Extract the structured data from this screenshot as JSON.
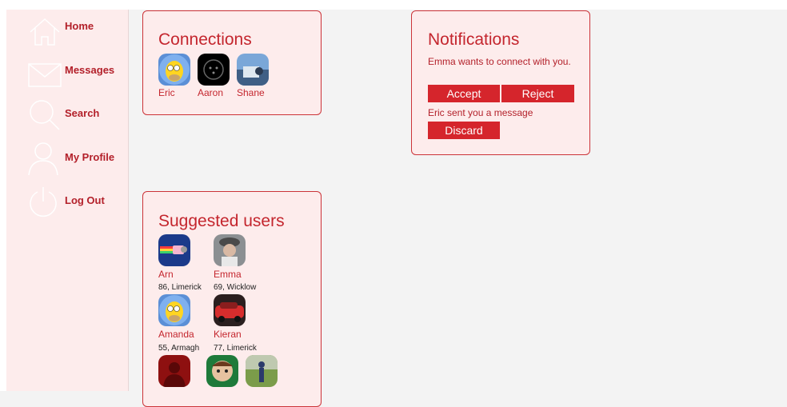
{
  "sidebar": {
    "items": [
      {
        "label": "Home",
        "icon": "home-icon"
      },
      {
        "label": "Messages",
        "icon": "envelope-icon"
      },
      {
        "label": "Search",
        "icon": "search-icon"
      },
      {
        "label": "My Profile",
        "icon": "user-icon"
      },
      {
        "label": "Log Out",
        "icon": "power-icon"
      }
    ]
  },
  "connections": {
    "title": "Connections",
    "users": [
      {
        "name": "Eric",
        "avatar": "homer-avatar-icon"
      },
      {
        "name": "Aaron",
        "avatar": "dark-avatar-icon"
      },
      {
        "name": "Shane",
        "avatar": "scene-avatar-icon"
      }
    ]
  },
  "notifications": {
    "title": "Notifications",
    "items": [
      {
        "text": "Emma wants to connect with you.",
        "actions": [
          "Accept",
          "Reject"
        ]
      },
      {
        "text": "Eric sent you a message",
        "actions": [
          "Discard"
        ]
      }
    ]
  },
  "suggested": {
    "title": "Suggested users",
    "users": [
      {
        "name": "Arn",
        "meta": "86, Limerick"
      },
      {
        "name": "Emma",
        "meta": "69, Wicklow"
      },
      {
        "name": "Amanda",
        "meta": "55, Armagh"
      },
      {
        "name": "Kieran",
        "meta": "77, Limerick"
      }
    ]
  },
  "colors": {
    "accent": "#d5252c",
    "card_bg": "#fdecec",
    "text_red": "#c4262e"
  }
}
